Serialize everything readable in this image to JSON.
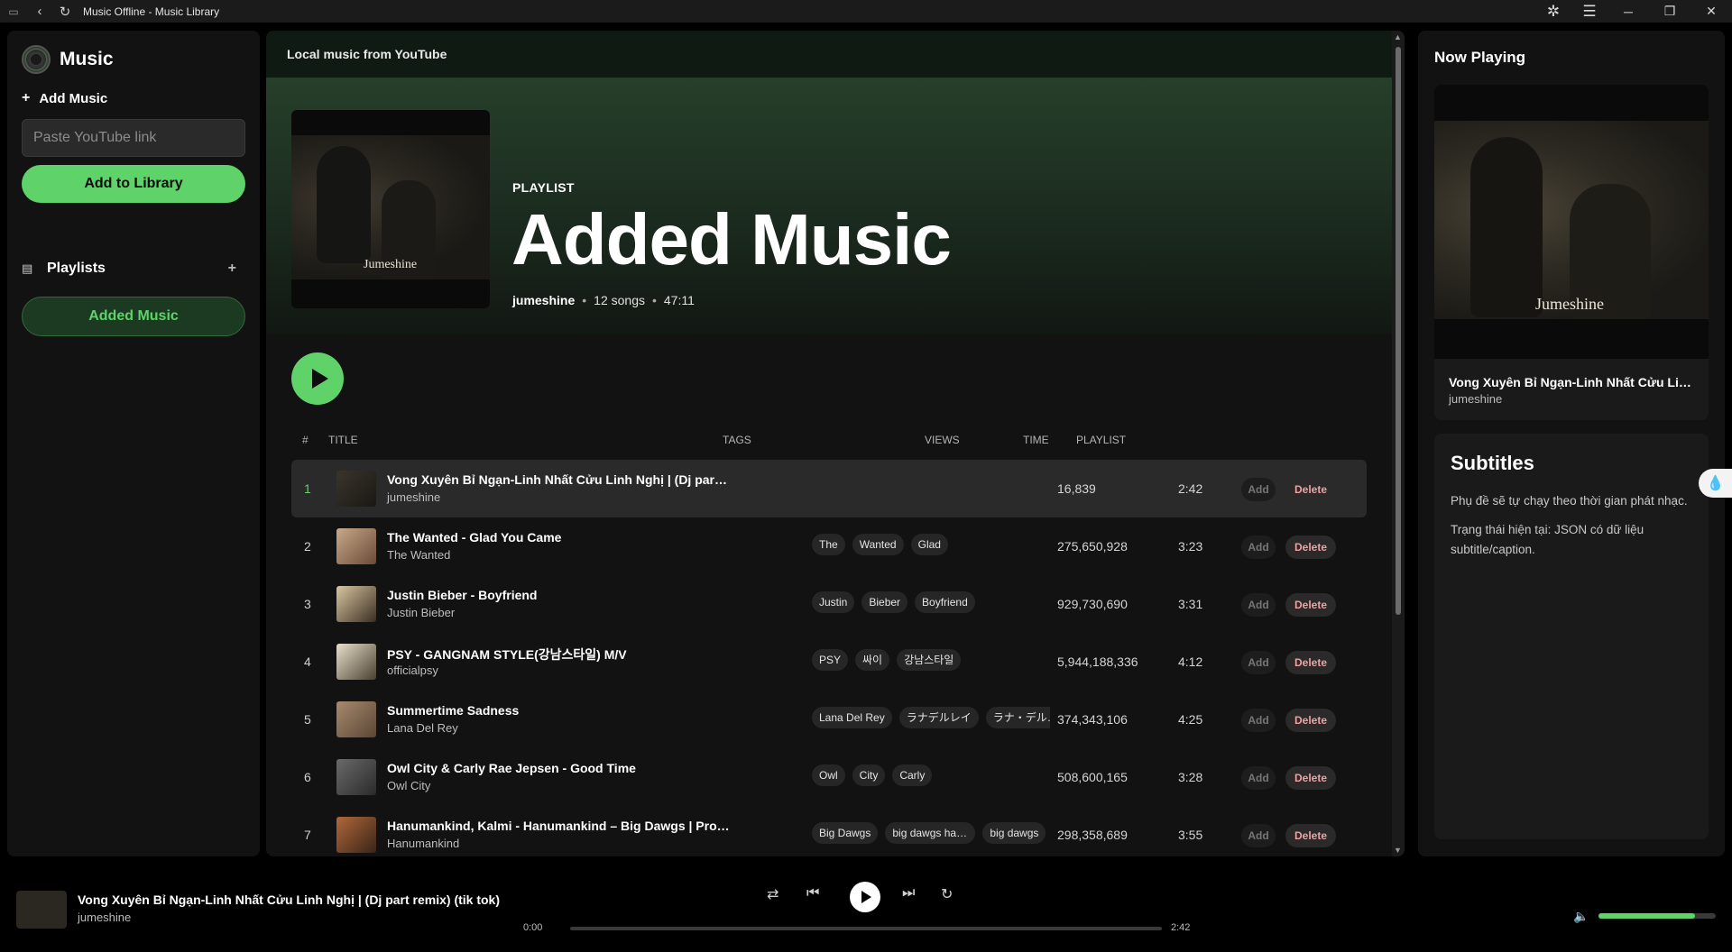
{
  "titlebar": {
    "title": "Music Offline - Music Library",
    "back_icon": "‹",
    "reload_icon": "↻",
    "minimize": "─",
    "maximize": "❐",
    "close": "✕"
  },
  "sidebar": {
    "app_name": "Music",
    "add_music_label": "Add Music",
    "youtube_placeholder": "Paste YouTube link",
    "add_button": "Add to Library",
    "playlists_label": "Playlists",
    "playlist_items": [
      "Added Music"
    ]
  },
  "main": {
    "header": "Local music from YouTube",
    "playlist_label": "PLAYLIST",
    "playlist_title": "Added Music",
    "owner": "jumeshine",
    "song_count": "12 songs",
    "duration": "47:11",
    "cover_signature": "Jumeshine",
    "columns": {
      "num": "#",
      "title": "TITLE",
      "tags": "TAGS",
      "views": "VIEWS",
      "time": "TIME",
      "playlist": "PLAYLIST"
    },
    "add_label": "Add",
    "delete_label": "Delete",
    "songs": [
      {
        "num": "1",
        "title": "Vong Xuyên Bỉ Ngạn-Linh Nhất Cửu Linh Nghị | (Dj part remix) (tik tok)",
        "artist": "jumeshine",
        "tags": [],
        "views": "16,839",
        "time": "2:42",
        "active": true
      },
      {
        "num": "2",
        "title": "The Wanted - Glad You Came",
        "artist": "The Wanted",
        "tags": [
          "The",
          "Wanted",
          "Glad"
        ],
        "views": "275,650,928",
        "time": "3:23"
      },
      {
        "num": "3",
        "title": "Justin Bieber - Boyfriend",
        "artist": "Justin Bieber",
        "tags": [
          "Justin",
          "Bieber",
          "Boyfriend"
        ],
        "views": "929,730,690",
        "time": "3:31"
      },
      {
        "num": "4",
        "title": "PSY - GANGNAM STYLE(강남스타일) M/V",
        "artist": "officialpsy",
        "tags": [
          "PSY",
          "싸이",
          "강남스타일"
        ],
        "views": "5,944,188,336",
        "time": "4:12"
      },
      {
        "num": "5",
        "title": "Summertime Sadness",
        "artist": "Lana Del Rey",
        "tags": [
          "Lana Del Rey",
          "ラナデルレイ",
          "ラナ・デル・レイ"
        ],
        "views": "374,343,106",
        "time": "4:25"
      },
      {
        "num": "6",
        "title": "Owl City & Carly Rae Jepsen - Good Time",
        "artist": "Owl City",
        "tags": [
          "Owl",
          "City",
          "Carly"
        ],
        "views": "508,600,165",
        "time": "3:28"
      },
      {
        "num": "7",
        "title": "Hanumankind, Kalmi - Hanumankind – Big Dawgs | Prod. Kalmi (Official Music Video)",
        "artist": "Hanumankind",
        "tags": [
          "Big Dawgs",
          "big dawgs hanumankind",
          "big dawgs"
        ],
        "views": "298,358,689",
        "time": "3:55"
      }
    ]
  },
  "now_playing": {
    "heading": "Now Playing",
    "song": "Vong Xuyên Bỉ Ngạn-Linh Nhất Cửu Linh Nghị | (Dj part remix) (tik tok)",
    "artist": "jumeshine",
    "art_signature": "Jumeshine",
    "subtitles_heading": "Subtitles",
    "subtitles_p1": "Phụ đề sẽ tự chạy theo thời gian phát nhạc.",
    "subtitles_p2": "Trạng thái hiện tại: JSON có dữ liệu subtitle/caption."
  },
  "player": {
    "song": "Vong Xuyên Bỉ Ngạn-Linh Nhất Cửu Linh Nghị | (Dj part remix) (tik tok)",
    "artist": "jumeshine",
    "time_current": "0:00",
    "time_total": "2:42",
    "progress": 0,
    "volume": 0.82
  },
  "colors": {
    "accent": "#5fd36a",
    "background": "#000000",
    "panel": "#121212"
  }
}
